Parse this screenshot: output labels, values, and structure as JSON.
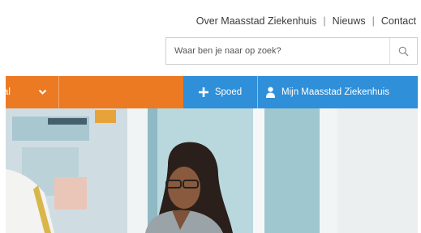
{
  "top_links": [
    {
      "label": "Over Maasstad Ziekenhuis"
    },
    {
      "label": "Nieuws"
    },
    {
      "label": "Contact"
    }
  ],
  "search": {
    "placeholder": "Waar ben je naar op zoek?",
    "icon": "search-icon"
  },
  "nav": {
    "first_item_label": "al",
    "first_item_icon": "chevron-down-icon",
    "spoed_label": "Spoed",
    "spoed_icon": "plus-icon",
    "account_label": "Mijn Maasstad Ziekenhuis",
    "account_icon": "person-icon"
  },
  "colors": {
    "orange": "#ec7a23",
    "blue": "#2f8fd8"
  }
}
